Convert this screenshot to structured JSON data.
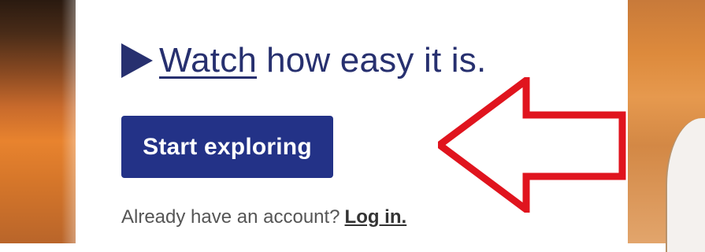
{
  "watch": {
    "link_text": "Watch",
    "rest_text": "how easy it is."
  },
  "start_button": {
    "label": "Start exploring"
  },
  "account": {
    "prompt": "Already have an account?",
    "login_link": "Log in."
  },
  "icons": {
    "play": "play-icon",
    "annotation_arrow": "red-outline-arrow-pointing-left"
  },
  "colors": {
    "brand_navy": "#233287",
    "text_navy": "#27306f",
    "annotation_red": "#e0141e"
  }
}
